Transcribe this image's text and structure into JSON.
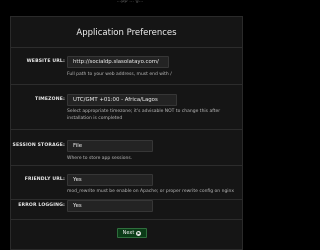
{
  "header": {
    "fragment": "...pp ... g..."
  },
  "panel": {
    "title": "Application Preferences"
  },
  "fields": {
    "website_url": {
      "label": "WEBSITE URL:",
      "value": "http://socialdp.slasolatayo.com/",
      "help": "Full path to your web address, must end with /"
    },
    "timezone": {
      "label": "TIMEZONE:",
      "value": "UTC/GMT +01:00 - Africa/Lagos",
      "help": "Select appropriate timezone; it's advisable NOT to change this after installation is completed"
    },
    "session_storage": {
      "label": "SESSION STORAGE:",
      "value": "File",
      "help": "Where to store app sessions."
    },
    "friendly_url": {
      "label": "FRIENDLY URL:",
      "value": "Yes",
      "help": "mod_rewrite must be enable on Apache; or proper rewrite config on nginx"
    },
    "error_logging": {
      "label": "ERROR LOGGING:",
      "value": "Yes"
    }
  },
  "actions": {
    "next_label": "Next"
  },
  "icons": {
    "next": "chevron-right-circle-icon"
  },
  "colors": {
    "background": "#000000",
    "panel": "#151515",
    "field": "#232323",
    "next_button": "#0b3b17"
  }
}
